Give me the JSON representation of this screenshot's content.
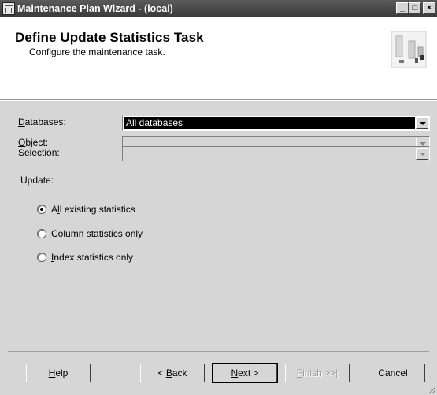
{
  "window": {
    "title": "Maintenance Plan Wizard - (local)",
    "min_glyph": "_",
    "max_glyph": "□",
    "close_glyph": "×"
  },
  "header": {
    "title": "Define Update Statistics Task",
    "subtitle": "Configure the maintenance task."
  },
  "form": {
    "databases": {
      "label_u": "D",
      "label_rest": "atabases:",
      "value": "All databases"
    },
    "object": {
      "label_u": "O",
      "label_rest": "bject:",
      "value": ""
    },
    "selection": {
      "label_pre": "Selec",
      "label_u": "t",
      "label_rest": "ion:",
      "value": ""
    }
  },
  "update": {
    "label": "Update:",
    "options": [
      {
        "pre": "A",
        "u": "l",
        "rest": "l existing statistics",
        "checked": true
      },
      {
        "pre": "Colu",
        "u": "m",
        "rest": "n statistics only",
        "checked": false
      },
      {
        "pre": "",
        "u": "I",
        "rest": "ndex statistics only",
        "checked": false
      }
    ]
  },
  "buttons": {
    "help": {
      "u": "H",
      "rest": "elp"
    },
    "back": {
      "pre": "< ",
      "u": "B",
      "rest": "ack"
    },
    "next": {
      "u": "N",
      "rest": "ext >"
    },
    "finish": {
      "u": "F",
      "rest": "inish >>|"
    },
    "cancel": "Cancel"
  }
}
